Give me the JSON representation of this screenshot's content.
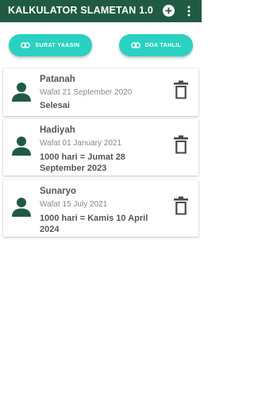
{
  "app": {
    "title": "KALKULATOR SLAMETAN 1.0",
    "accent_color": "#215a43",
    "chip_color": "#2ad1c0",
    "actions": {
      "add_icon": "add-circle-icon",
      "menu_icon": "more-vert-icon"
    }
  },
  "chips": [
    {
      "label": "SURAT YAASIN",
      "icon": "link-icon"
    },
    {
      "label": "DOA TAHLIL",
      "icon": "link-icon"
    }
  ],
  "entries": [
    {
      "name": "Patanah",
      "date": "Wafat 21 September 2020",
      "status": "Selesai",
      "avatar_icon": "person-icon",
      "delete_icon": "trash-icon"
    },
    {
      "name": "Hadiyah",
      "date": "Wafat 01 January 2021",
      "status": "1000 hari = Jumat 28 September 2023",
      "avatar_icon": "person-icon",
      "delete_icon": "trash-icon"
    },
    {
      "name": "Sunaryo",
      "date": "Wafat 15 July 2021",
      "status": "1000 hari = Kamis 10 April 2024",
      "avatar_icon": "person-icon",
      "delete_icon": "trash-icon"
    }
  ]
}
